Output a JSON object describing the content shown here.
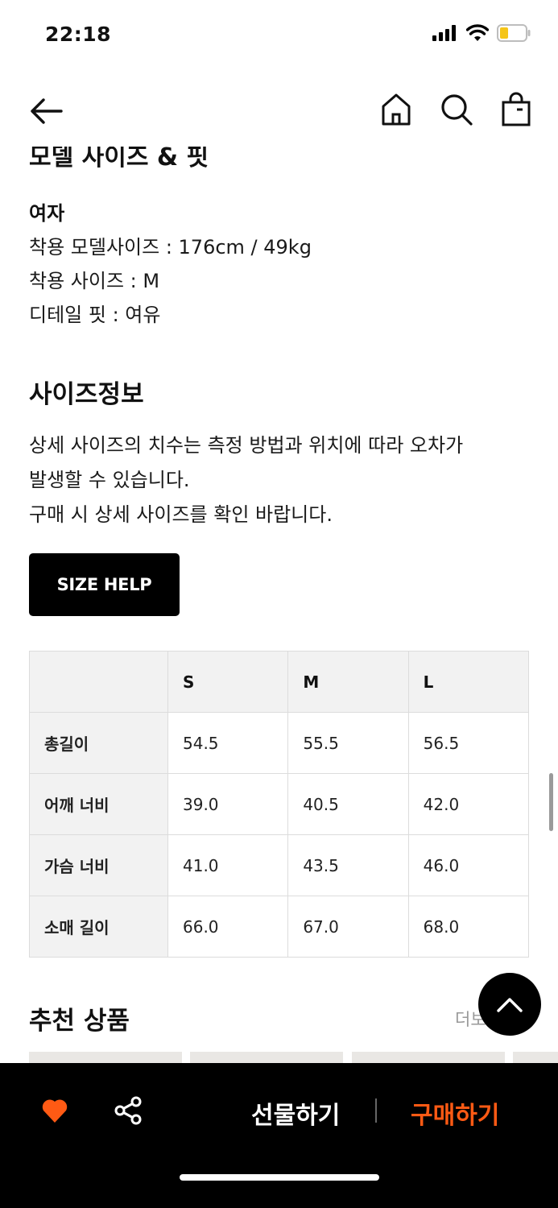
{
  "status_bar": {
    "time": "22:18"
  },
  "nav": {
    "back_icon": "arrow-left-icon",
    "home_icon": "home-icon",
    "search_icon": "search-icon",
    "bag_icon": "shopping-bag-icon"
  },
  "model_section": {
    "heading": "모델 사이즈 & 핏",
    "gender": "여자",
    "lines": [
      "착용 모델사이즈 : 176cm / 49kg",
      "착용 사이즈 : M",
      "디테일 핏 : 여유"
    ]
  },
  "size_info": {
    "title": "사이즈정보",
    "description": [
      "상세 사이즈의 치수는 측정 방법과 위치에 따라 오차가",
      "발생할 수 있습니다.",
      "구매 시 상세 사이즈를 확인 바랍니다."
    ],
    "help_button": "SIZE HELP",
    "table": {
      "headers": [
        "",
        "S",
        "M",
        "L"
      ],
      "rows": [
        {
          "label": "총길이",
          "values": [
            "54.5",
            "55.5",
            "56.5"
          ]
        },
        {
          "label": "어깨 너비",
          "values": [
            "39.0",
            "40.5",
            "42.0"
          ]
        },
        {
          "label": "가슴 너비",
          "values": [
            "41.0",
            "43.5",
            "46.0"
          ]
        },
        {
          "label": "소매 길이",
          "values": [
            "66.0",
            "67.0",
            "68.0"
          ]
        }
      ]
    }
  },
  "recommend": {
    "title": "추천 상품",
    "more": "더보"
  },
  "bottom_bar": {
    "gift_label": "선물하기",
    "buy_label": "구매하기",
    "heart_color": "#ff5a14",
    "buy_color": "#ff5a14"
  }
}
